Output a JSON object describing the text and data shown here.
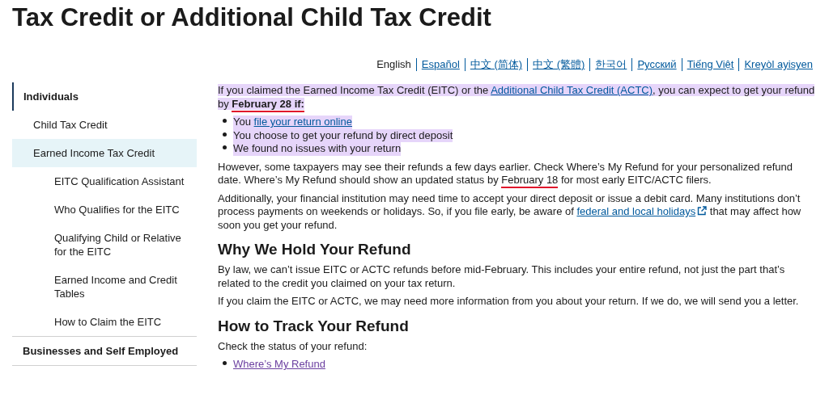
{
  "title": "Tax Credit or Additional Child Tax Credit",
  "languages": [
    {
      "label": "English",
      "selected": true
    },
    {
      "label": "Español",
      "selected": false
    },
    {
      "label": "中文 (简体)",
      "selected": false
    },
    {
      "label": "中文 (繁體)",
      "selected": false
    },
    {
      "label": "한국어",
      "selected": false
    },
    {
      "label": "Русский",
      "selected": false
    },
    {
      "label": "Tiếng Việt",
      "selected": false
    },
    {
      "label": "Kreyòl ayisyen",
      "selected": false
    }
  ],
  "sidebar": {
    "items": [
      {
        "label": "Individuals",
        "selected": false,
        "children": [
          {
            "label": "Child Tax Credit",
            "selected": false
          },
          {
            "label": "Earned Income Tax Credit",
            "selected": true,
            "children": [
              {
                "label": "EITC Qualification Assistant",
                "selected": false
              },
              {
                "label": "Who Qualifies for the EITC",
                "selected": false
              },
              {
                "label": "Qualifying Child or Relative for the EITC",
                "selected": false
              },
              {
                "label": "Earned Income and Credit Tables",
                "selected": false
              },
              {
                "label": "How to Claim the EITC",
                "selected": false
              }
            ]
          }
        ]
      },
      {
        "label": "Businesses and Self Employed",
        "selected": false
      }
    ]
  },
  "content": [
    {
      "kind": "paragraph",
      "highlighted": true,
      "parts": [
        {
          "kind": "text",
          "text": "If you claimed the Earned Income Tax Credit (EITC) or the ",
          "marked": false
        },
        {
          "kind": "link",
          "text": "Additional Child Tax Credit (ACTC)",
          "marked": false
        },
        {
          "kind": "text",
          "text": ", you can expect to get your refund by ",
          "marked": false
        },
        {
          "kind": "bold",
          "text": "February 28 if:",
          "marked": true
        }
      ]
    },
    {
      "kind": "list",
      "items": [
        {
          "highlighted": true,
          "parts": [
            {
              "kind": "text",
              "text": "You ",
              "marked": false
            },
            {
              "kind": "link",
              "text": "file your return online",
              "marked": false
            }
          ]
        },
        {
          "highlighted": true,
          "parts": [
            {
              "kind": "text",
              "text": "You choose to get your refund by direct deposit",
              "marked": false
            }
          ]
        },
        {
          "highlighted": true,
          "parts": [
            {
              "kind": "text",
              "text": "We found no issues with your return",
              "marked": false
            }
          ]
        }
      ]
    },
    {
      "kind": "paragraph",
      "highlighted": false,
      "parts": [
        {
          "kind": "text",
          "text": "However, some taxpayers may see their refunds a few days earlier. Check Where’s My Refund for your personalized refund date. Where’s My Refund should show an updated status by ",
          "marked": false
        },
        {
          "kind": "text",
          "text": "February 18",
          "marked": true
        },
        {
          "kind": "text",
          "text": " for most early EITC/ACTC filers.",
          "marked": false
        }
      ]
    },
    {
      "kind": "paragraph",
      "highlighted": false,
      "parts": [
        {
          "kind": "text",
          "text": "Additionally, your financial institution may need time to accept your direct deposit or issue a debit card. Many institutions don’t process payments on weekends or holidays. So, if you file early, be aware of ",
          "marked": false
        },
        {
          "kind": "external-link",
          "text": "federal and local holidays",
          "marked": false
        },
        {
          "kind": "text",
          "text": " that may affect how soon you get your refund.",
          "marked": false
        }
      ]
    },
    {
      "kind": "heading",
      "text": "Why We Hold Your Refund"
    },
    {
      "kind": "paragraph",
      "highlighted": false,
      "parts": [
        {
          "kind": "text",
          "text": "By law, we can’t issue EITC or ACTC refunds before mid-February. This includes your entire refund, not just the part that’s related to the credit you claimed on your tax return.",
          "marked": false
        }
      ]
    },
    {
      "kind": "paragraph",
      "highlighted": false,
      "parts": [
        {
          "kind": "text",
          "text": "If you claim the EITC or ACTC, we may need more information from you about your return. If we do, we will send you a letter.",
          "marked": false
        }
      ]
    },
    {
      "kind": "heading",
      "text": "How to Track Your Refund"
    },
    {
      "kind": "paragraph",
      "highlighted": false,
      "parts": [
        {
          "kind": "text",
          "text": "Check the status of your refund:",
          "marked": false
        }
      ]
    },
    {
      "kind": "list",
      "items": [
        {
          "highlighted": false,
          "parts": [
            {
              "kind": "visited-link",
              "text": "Where’s My Refund",
              "marked": false
            }
          ]
        }
      ]
    }
  ]
}
